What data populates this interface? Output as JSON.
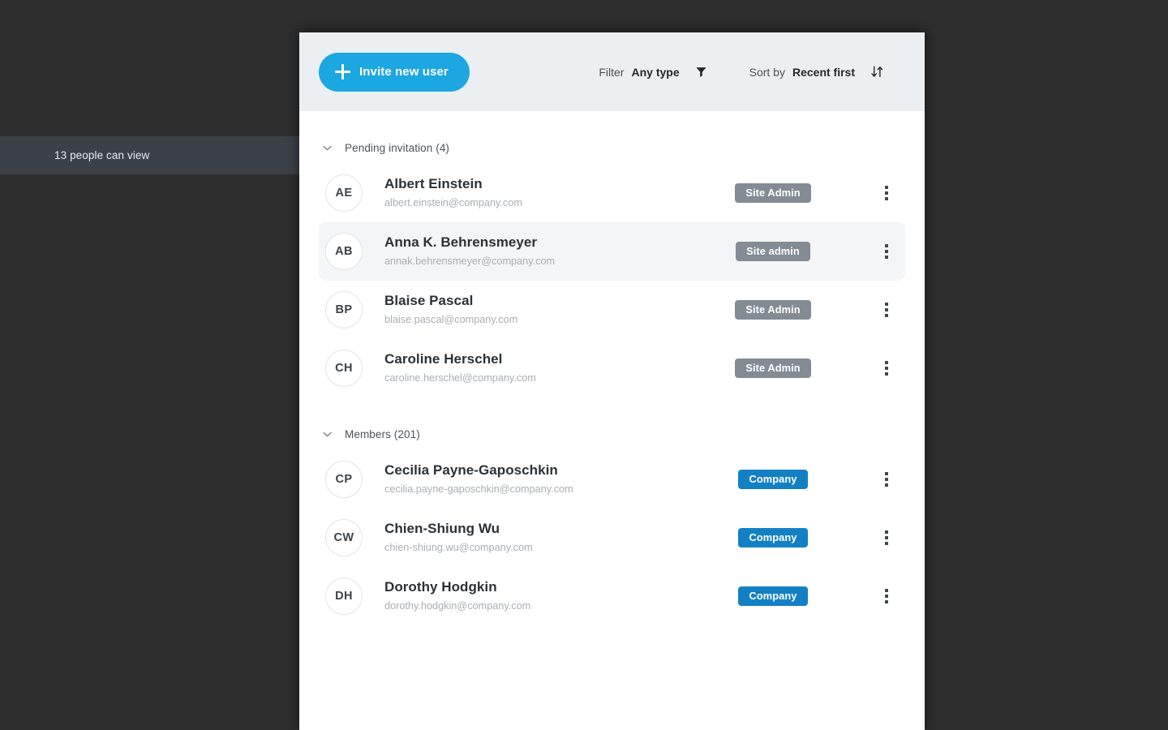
{
  "backdrop": {
    "viewers_label": "13 people can view"
  },
  "toolbar": {
    "invite_label": "Invite new user",
    "invite_icon": "plus-icon",
    "invite_color": "#1ca7e0",
    "filter": {
      "label": "Filter",
      "value": "Any type",
      "icon": "funnel-icon"
    },
    "sort": {
      "label": "Sort by",
      "value": "Recent first",
      "icon": "sort-arrows-icon"
    }
  },
  "sections": [
    {
      "title": "Pending invitation (4)",
      "chevron": "chevron-down-icon",
      "rows": [
        {
          "initials": "AE",
          "name": "Albert Einstein",
          "email": "albert.einstein@company.com",
          "badge": "Site Admin",
          "badge_style": "gray",
          "highlight": false
        },
        {
          "initials": "AB",
          "name": "Anna K. Behrensmeyer",
          "email": "annak.behrensmeyer@company.com",
          "badge": "Site admin",
          "badge_style": "gray",
          "highlight": true
        },
        {
          "initials": "BP",
          "name": "Blaise Pascal",
          "email": "blaise.pascal@company.com",
          "badge": "Site Admin",
          "badge_style": "gray",
          "highlight": false
        },
        {
          "initials": "CH",
          "name": "Caroline Herschel",
          "email": "caroline.herschel@company.com",
          "badge": "Site Admin",
          "badge_style": "gray",
          "highlight": false
        }
      ]
    },
    {
      "title": "Members (201)",
      "chevron": "chevron-down-icon",
      "rows": [
        {
          "initials": "CP",
          "name": "Cecilia Payne-Gaposchkin",
          "email": "cecilia.payne-gaposchkin@company.com",
          "badge": "Company",
          "badge_style": "blue",
          "highlight": false
        },
        {
          "initials": "CW",
          "name": "Chien-Shiung Wu",
          "email": "chien-shiung.wu@company.com",
          "badge": "Company",
          "badge_style": "blue",
          "highlight": false
        },
        {
          "initials": "DH",
          "name": "Dorothy Hodgkin",
          "email": "dorothy.hodgkin@company.com",
          "badge": "Company",
          "badge_style": "blue",
          "highlight": false
        }
      ]
    }
  ],
  "cursor": {
    "type": "pointing-hand-cursor"
  },
  "colors": {
    "accent": "#1ca7e0",
    "badge_gray": "#838b94",
    "badge_blue": "#1480c4",
    "toolbar_bg": "#eceff1",
    "backdrop": "#2e2e2e",
    "backdrop_band": "#3c4148"
  }
}
